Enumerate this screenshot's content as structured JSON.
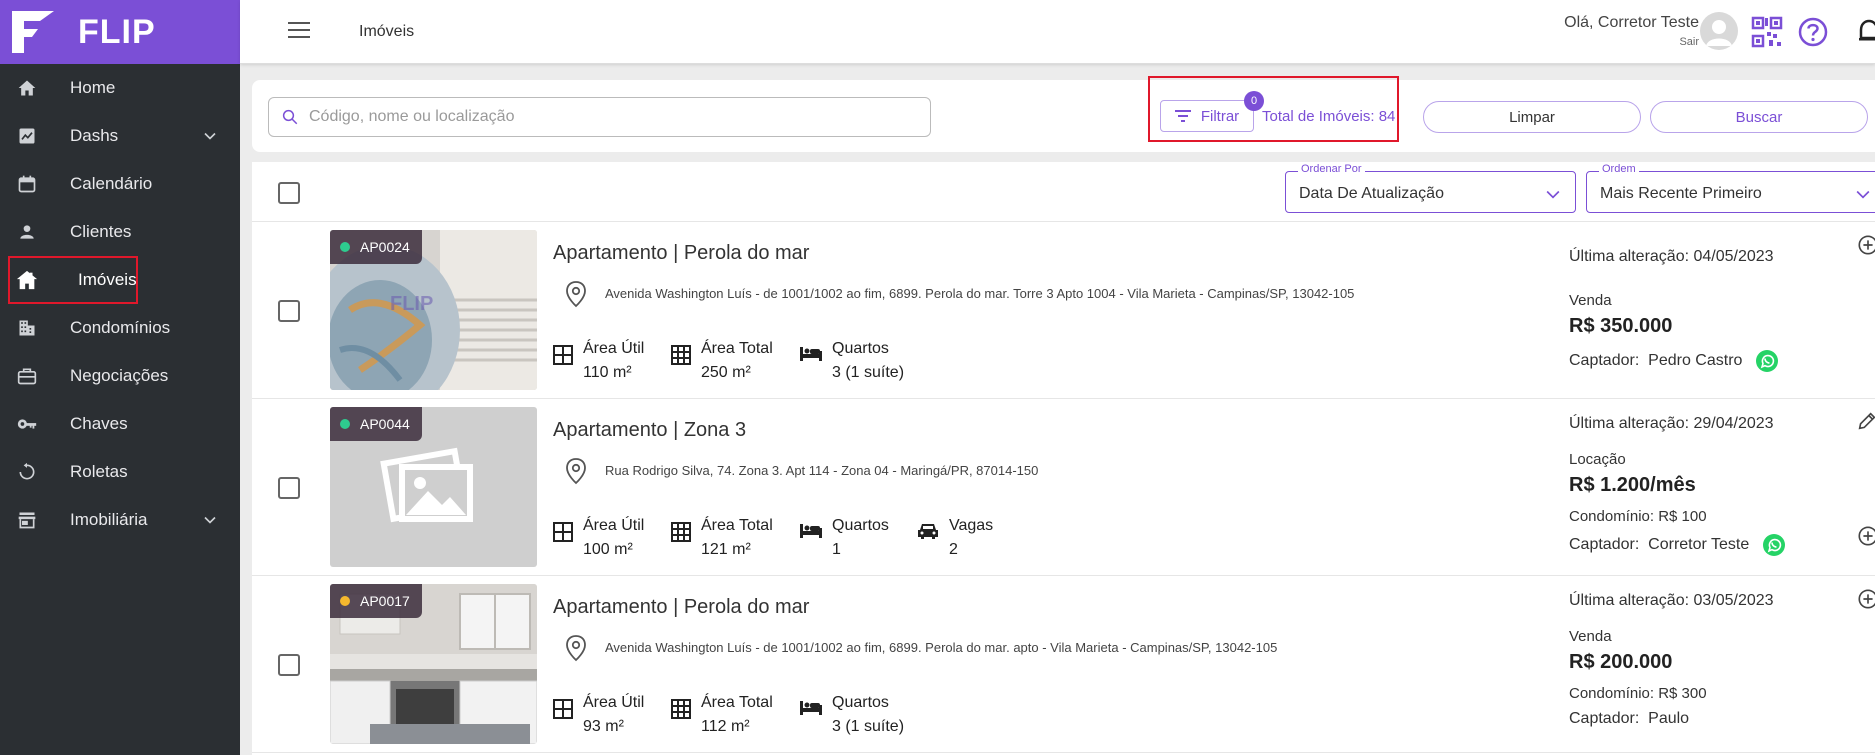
{
  "brand": {
    "name": "FLIP",
    "color": "#7b4fd6"
  },
  "sidebar": {
    "items": [
      {
        "label": "Home",
        "icon": "home-icon"
      },
      {
        "label": "Dashs",
        "icon": "chart-icon"
      },
      {
        "label": "Calendário",
        "icon": "calendar-icon"
      },
      {
        "label": "Clientes",
        "icon": "person-icon"
      },
      {
        "label": "Imóveis",
        "icon": "house-icon"
      },
      {
        "label": "Condomínios",
        "icon": "buildings-icon"
      },
      {
        "label": "Negociações",
        "icon": "briefcase-icon"
      },
      {
        "label": "Chaves",
        "icon": "key-icon"
      },
      {
        "label": "Roletas",
        "icon": "refresh-icon"
      },
      {
        "label": "Imobiliária",
        "icon": "store-icon"
      }
    ],
    "active": "Imóveis"
  },
  "header": {
    "title": "Imóveis",
    "greeting": "Olá, Corretor Teste",
    "logout": "Sair"
  },
  "search": {
    "placeholder": "Código, nome ou localização",
    "value": "",
    "filter_label": "Filtrar",
    "filter_count": "0",
    "total_label": "Total de Imóveis: 84",
    "clear_label": "Limpar",
    "search_label": "Buscar"
  },
  "sort": {
    "order_by_legend": "Ordenar Por",
    "order_by_value": "Data De Atualização",
    "order_legend": "Ordem",
    "order_value": "Mais Recente Primeiro"
  },
  "listings": [
    {
      "code": "AP0024",
      "status_color": "#2ecc8f",
      "title": "Apartamento | Perola do mar",
      "address": "Avenida Washington Luís - de 1001/1002 ao fim, 6899. Perola do mar. Torre 3 Apto 1004 - Vila Marieta - Campinas/SP, 13042-105",
      "features": [
        {
          "label": "Área Útil",
          "value": "110 m²",
          "icon": "area-icon"
        },
        {
          "label": "Área Total",
          "value": "250 m²",
          "icon": "grid-icon"
        },
        {
          "label": "Quartos",
          "value": "3 (1 suíte)",
          "icon": "bed-icon"
        }
      ],
      "updated": "Última alteração: 04/05/2023",
      "deal_type": "Venda",
      "price": "R$ 350.000",
      "condo": "",
      "captador_label": "Captador:",
      "captador": "Pedro Castro",
      "whatsapp": true,
      "action_icon": "add-circle-icon"
    },
    {
      "code": "AP0044",
      "status_color": "#2ecc8f",
      "title": "Apartamento | Zona 3",
      "address": "Rua Rodrigo Silva, 74. Zona 3. Apt 114 - Zona 04 - Maringá/PR, 87014-150",
      "features": [
        {
          "label": "Área Útil",
          "value": "100 m²",
          "icon": "area-icon"
        },
        {
          "label": "Área Total",
          "value": "121 m²",
          "icon": "grid-icon"
        },
        {
          "label": "Quartos",
          "value": "1",
          "icon": "bed-icon"
        },
        {
          "label": "Vagas",
          "value": "2",
          "icon": "car-icon"
        }
      ],
      "updated": "Última alteração: 29/04/2023",
      "deal_type": "Locação",
      "price": "R$ 1.200/mês",
      "condo": "Condomínio: R$ 100",
      "captador_label": "Captador:",
      "captador": "Corretor Teste",
      "whatsapp": true,
      "action_icon": "edit-icon"
    },
    {
      "code": "AP0017",
      "status_color": "#f5b82e",
      "title": "Apartamento | Perola do mar",
      "address": "Avenida Washington Luís - de 1001/1002 ao fim, 6899. Perola do mar. apto - Vila Marieta - Campinas/SP, 13042-105",
      "features": [
        {
          "label": "Área Útil",
          "value": "93 m²",
          "icon": "area-icon"
        },
        {
          "label": "Área Total",
          "value": "112 m²",
          "icon": "grid-icon"
        },
        {
          "label": "Quartos",
          "value": "3 (1 suíte)",
          "icon": "bed-icon"
        }
      ],
      "updated": "Última alteração: 03/05/2023",
      "deal_type": "Venda",
      "price": "R$ 200.000",
      "condo": "Condomínio: R$ 300",
      "captador_label": "Captador:",
      "captador": "Paulo",
      "whatsapp": false,
      "action_icon": "add-circle-icon"
    }
  ]
}
